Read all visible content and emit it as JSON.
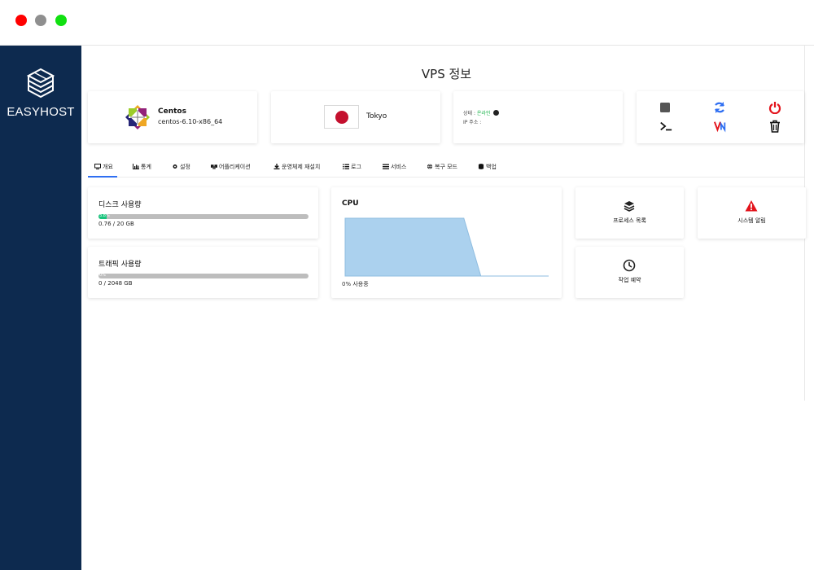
{
  "window": {
    "controls": [
      "close",
      "minimize",
      "maximize"
    ]
  },
  "sidebar": {
    "brand": "EASYHOST",
    "logo_icon": "cube-stack-icon"
  },
  "page": {
    "title": "VPS 정보"
  },
  "os": {
    "name": "Centos",
    "version": "centos-6.10-x86_64",
    "icon": "centos-logo-icon"
  },
  "location": {
    "name": "Tokyo",
    "flag": "japan-flag-icon"
  },
  "status": {
    "label": "상태 :",
    "value": "온라인",
    "ip_label": "IP 주소 :",
    "ip_value": ""
  },
  "actions": [
    {
      "name": "stop",
      "icon": "stop-icon",
      "color": "#555555"
    },
    {
      "name": "refresh",
      "icon": "refresh-icon",
      "color": "#2f6ff2"
    },
    {
      "name": "power",
      "icon": "power-icon",
      "color": "#e3141c"
    },
    {
      "name": "console",
      "icon": "terminal-icon",
      "color": "#111111"
    },
    {
      "name": "vnc",
      "icon": "vnc-icon",
      "color": "#e3141c"
    },
    {
      "name": "delete",
      "icon": "trash-icon",
      "color": "#111111"
    }
  ],
  "tabs": [
    {
      "label": "개요",
      "icon": "monitor-icon",
      "active": true
    },
    {
      "label": "통계",
      "icon": "chart-icon",
      "active": false
    },
    {
      "label": "설정",
      "icon": "gear-icon",
      "active": false
    },
    {
      "label": "어플리케이션",
      "icon": "cubes-icon",
      "active": false
    },
    {
      "label": "운영체제 재설치",
      "icon": "download-icon",
      "active": false
    },
    {
      "label": "로그",
      "icon": "list-icon",
      "active": false
    },
    {
      "label": "서비스",
      "icon": "bars-icon",
      "active": false
    },
    {
      "label": "복구 모드",
      "icon": "globe-icon",
      "active": false
    },
    {
      "label": "백업",
      "icon": "database-icon",
      "active": false
    }
  ],
  "disk": {
    "title": "디스크 사용량",
    "percent": 3.8,
    "bar_label": "3.8%",
    "used": "0.76 / 20 GB"
  },
  "traffic": {
    "title": "트래픽 사용량",
    "percent": 0,
    "bar_label": "0%",
    "used": "0 / 2048 GB"
  },
  "cpu": {
    "title": "CPU",
    "usage_text": "0% 사용중"
  },
  "chart_data": {
    "type": "area",
    "title": "CPU",
    "x": [
      0,
      1,
      2,
      3,
      4,
      5,
      6,
      7,
      8,
      9,
      10,
      11,
      12
    ],
    "values": [
      100,
      100,
      100,
      100,
      100,
      100,
      100,
      100,
      0,
      0,
      0,
      0,
      0
    ],
    "ylim": [
      0,
      100
    ],
    "color": "#abd1ee",
    "line_color": "#8fbde0",
    "grid": false
  },
  "tiles": [
    {
      "label": "프로세스 목록",
      "icon": "layers-icon",
      "color": "#222222"
    },
    {
      "label": "시스템 알림",
      "icon": "warning-icon",
      "color": "#e3141c"
    },
    {
      "label": "작업 예약",
      "icon": "clock-icon",
      "color": "#222222"
    }
  ]
}
